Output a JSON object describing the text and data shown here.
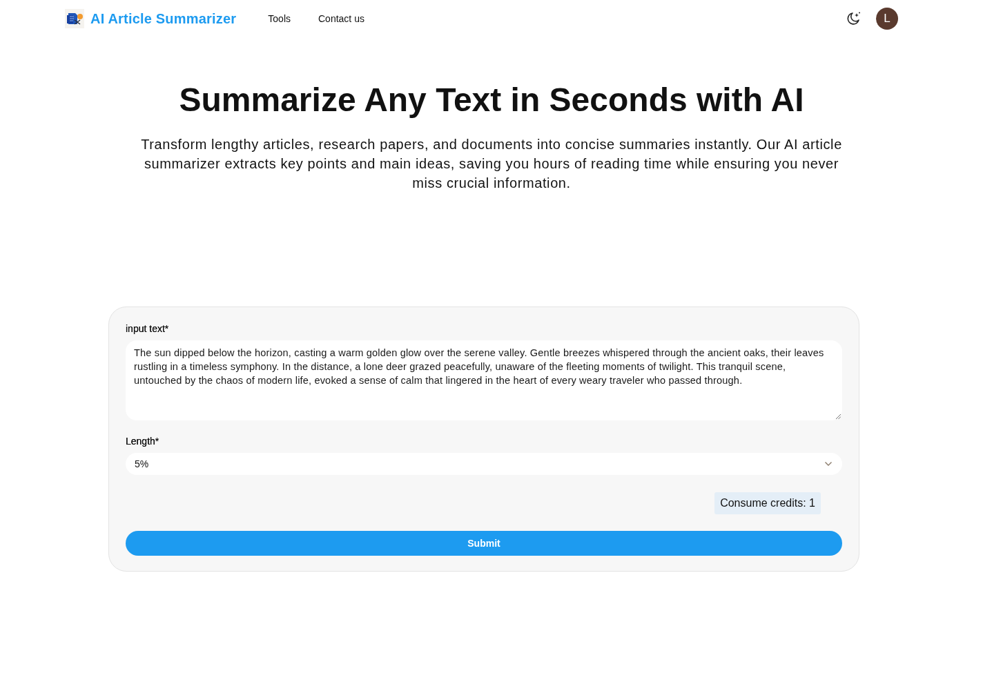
{
  "header": {
    "brand": "AI Article Summarizer",
    "nav_links": [
      "Tools",
      "Contact us"
    ],
    "avatar_initial": "L"
  },
  "hero": {
    "title": "Summarize Any Text in Seconds with AI",
    "subtitle": "Transform lengthy articles, research papers, and documents into concise summaries instantly. Our AI article summarizer extracts key points and main ideas, saving you hours of reading time while ensuring you never miss crucial information."
  },
  "form": {
    "fields": [
      {
        "kind": "textarea",
        "label": "input text*",
        "value": "The sun dipped below the horizon, casting a warm golden glow over the serene valley. Gentle breezes whispered through the ancient oaks, their leaves rustling in a timeless symphony. In the distance, a lone deer grazed peacefully, unaware of the fleeting moments of twilight. This tranquil scene, untouched by the chaos of modern life, evoked a sense of calm that lingered in the heart of every weary traveler who passed through."
      },
      {
        "kind": "select",
        "label": "Length*",
        "value": "5%"
      }
    ],
    "credits_badge": "Consume credits: 1",
    "submit_button": "Submit"
  }
}
